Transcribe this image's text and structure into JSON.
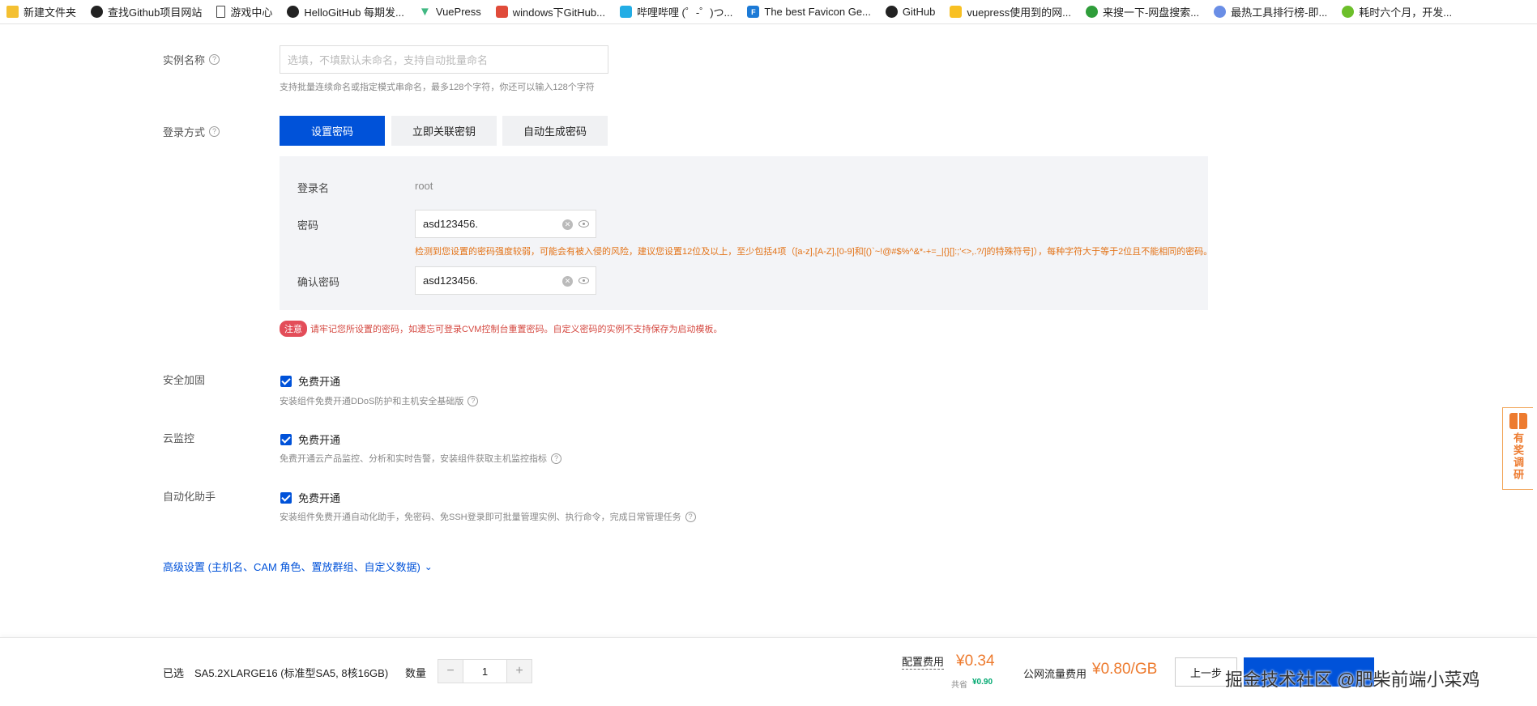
{
  "bookmarks": [
    {
      "label": "新建文件夹",
      "icon": "folder-icon"
    },
    {
      "label": "查找Github项目网站",
      "icon": "github-icon"
    },
    {
      "label": "游戏中心",
      "icon": "document-icon"
    },
    {
      "label": "HelloGitHub 每期发...",
      "icon": "github-icon"
    },
    {
      "label": "VuePress",
      "icon": "vue-icon"
    },
    {
      "label": "windows下GitHub...",
      "icon": "site-icon"
    },
    {
      "label": "哔哩哔哩 (゜-゜)つ...",
      "icon": "bilibili-icon"
    },
    {
      "label": "The best Favicon Ge...",
      "icon": "favicon-icon"
    },
    {
      "label": "GitHub",
      "icon": "github-icon"
    },
    {
      "label": "vuepress使用到的网...",
      "icon": "site-icon"
    },
    {
      "label": "来搜一下-网盘搜索...",
      "icon": "site-icon"
    },
    {
      "label": "最热工具排行榜-即...",
      "icon": "site-icon"
    },
    {
      "label": "耗时六个月，开发...",
      "icon": "site-icon"
    }
  ],
  "form": {
    "instance_name": {
      "label": "实例名称",
      "placeholder": "选填，不填默认未命名，支持自动批量命名",
      "hint": "支持批量连续命名或指定模式串命名，最多128个字符，你还可以输入128个字符"
    },
    "login": {
      "label": "登录方式",
      "options": [
        "设置密码",
        "立即关联密钥",
        "自动生成密码"
      ],
      "selected": "设置密码",
      "username_label": "登录名",
      "username": "root",
      "password_label": "密码",
      "password": "asd123456.",
      "warning": "检测到您设置的密码强度较弱，可能会有被入侵的风险，建议您设置12位及以上，至少包括4项（[a-z],[A-Z],[0-9]和[()`~!@#$%^&*-+=_|{}[]:;'<>,.?/]的特殊符号]），每种字符大于等于2位且不能相同的密码。",
      "confirm_label": "确认密码",
      "confirm_password": "asd123456.",
      "notice_tag": "注意",
      "notice": "请牢记您所设置的密码，如遗忘可登录CVM控制台重置密码。自定义密码的实例不支持保存为启动模板。"
    },
    "security": {
      "label": "安全加固",
      "checkbox_label": "免费开通",
      "checked": true,
      "hint": "安装组件免费开通DDoS防护和主机安全基础版"
    },
    "monitor": {
      "label": "云监控",
      "checkbox_label": "免费开通",
      "checked": true,
      "hint": "免费开通云产品监控、分析和实时告警，安装组件获取主机监控指标"
    },
    "automation": {
      "label": "自动化助手",
      "checkbox_label": "免费开通",
      "checked": true,
      "hint": "安装组件免费开通自动化助手，免密码、免SSH登录即可批量管理实例、执行命令，完成日常管理任务"
    },
    "advanced": "高级设置 (主机名、CAM 角色、置放群组、自定义数据)"
  },
  "footer": {
    "selected_label": "已选",
    "selected_spec": "SA5.2XLARGE16 (标准型SA5, 8核16GB)",
    "quantity_label": "数量",
    "quantity": "1",
    "config_fee_label": "配置费用",
    "config_fee": "¥0.34",
    "saved_label": "共省",
    "saved": "¥0.90",
    "traffic_fee_label": "公网流量费用",
    "traffic_fee": "¥0.80/GB",
    "prev_label": "上一步",
    "watermark": "掘金技术社区 @肥柴前端小菜鸡"
  },
  "survey": {
    "label": "有奖调研"
  },
  "colors": {
    "primary": "#0052d9",
    "warning": "#e37318",
    "error": "#d54941",
    "price": "#ed7b2f",
    "saved": "#00a870"
  }
}
